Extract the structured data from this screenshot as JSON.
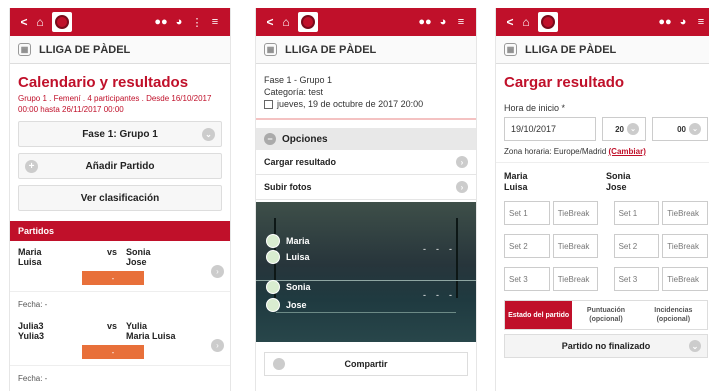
{
  "common": {
    "league_name": "LLIGA DE PÀDEL",
    "back_glyph": "<",
    "home_glyph": "⌂",
    "menu_glyph": "≡",
    "more_glyph": "⋮",
    "accent": "#c0102a",
    "score_color": "#e8703a"
  },
  "screen1": {
    "title": "Calendario y resultados",
    "subtitle": "Grupo 1 . Femení . 4 participantes . Desde 16/10/2017 00:00 hasta 26/11/2017 00:00",
    "phase_select": "Fase 1: Grupo 1",
    "add_match": "Añadir Partido",
    "view_ranking": "Ver clasificación",
    "section": "Partidos",
    "matches": [
      {
        "a1": "Maria",
        "a2": "Luisa",
        "vs": "vs",
        "b1": "Sonia",
        "b2": "Jose",
        "score": "-"
      },
      {
        "a1": "Julia3",
        "a2": "Yulia3",
        "vs": "vs",
        "b1": "Yulia",
        "b2": "Maria Luisa",
        "score": "-"
      }
    ],
    "fecha": "Fecha: -",
    "fecha2": "Fecha: -"
  },
  "screen2": {
    "phase": "Fase 1 - Grupo 1",
    "category": "Categoría: test",
    "datetime": "jueves, 19 de octubre de 2017 20:00",
    "options_title": "Opciones",
    "option_upload_result": "Cargar resultado",
    "option_upload_photos": "Subir fotos",
    "players": [
      "Maria",
      "Luisa",
      "Sonia",
      "Jose"
    ],
    "dash": "-",
    "share": "Compartir"
  },
  "screen3": {
    "title": "Cargar resultado",
    "start_label": "Hora de inicio *",
    "date_value": "19/10/2017",
    "hour_value": "20",
    "minute_value": "00",
    "tz_text": "Zona horaria: Europe/Madrid",
    "tz_link": "(Cambiar)",
    "team_a_1": "Maria",
    "team_a_2": "Luisa",
    "team_b_1": "Sonia",
    "team_b_2": "Jose",
    "sets": [
      {
        "set": "Set 1",
        "tb": "TieBreak"
      },
      {
        "set": "Set 2",
        "tb": "TieBreak"
      },
      {
        "set": "Set 3",
        "tb": "TieBreak"
      }
    ],
    "tab_status": "Estado del partido",
    "tab_score": "Puntuación (opcional)",
    "tab_incidents": "Incidencias (opcional)",
    "status_value": "Partido no finalizado"
  }
}
